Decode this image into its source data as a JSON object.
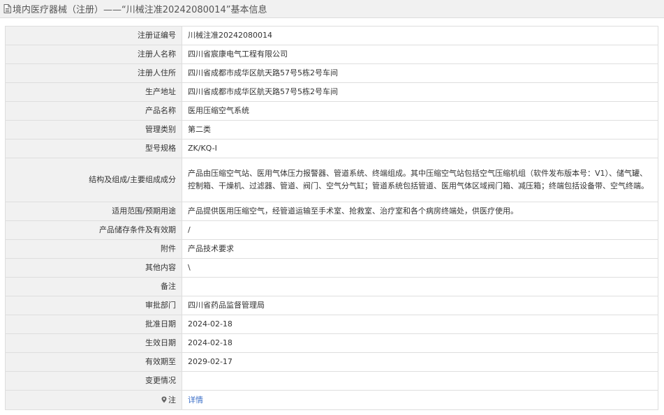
{
  "header": {
    "title": "境内医疗器械（注册）——“川械注准20242080014”基本信息"
  },
  "rows": [
    {
      "label": "注册证编号",
      "value": "川械注准20242080014"
    },
    {
      "label": "注册人名称",
      "value": "四川省宸康电气工程有限公司"
    },
    {
      "label": "注册人住所",
      "value": "四川省成都市成华区航天路57号5栋2号车间"
    },
    {
      "label": "生产地址",
      "value": "四川省成都市成华区航天路57号5栋2号车间"
    },
    {
      "label": "产品名称",
      "value": "医用压缩空气系统"
    },
    {
      "label": "管理类别",
      "value": "第二类"
    },
    {
      "label": "型号规格",
      "value": "ZK/KQ-I"
    },
    {
      "label": "结构及组成/主要组成成分",
      "value": "产品由压缩空气站、医用气体压力报警器、管道系统、终端组成。其中压缩空气站包括空气压缩机组（软件发布版本号：V1）、储气罐、控制箱、干燥机、过滤器、管道、阀门、空气分气缸；管道系统包括管道、医用气体区域阀门箱、减压箱；终端包括设备带、空气终端。"
    },
    {
      "label": "适用范围/预期用途",
      "value": "产品提供医用压缩空气，经管道运输至手术室、抢救室、治疗室和各个病房终端处，供医疗使用。"
    },
    {
      "label": "产品储存条件及有效期",
      "value": "/"
    },
    {
      "label": "附件",
      "value": "产品技术要求"
    },
    {
      "label": "其他内容",
      "value": "\\"
    },
    {
      "label": "备注",
      "value": ""
    },
    {
      "label": "审批部门",
      "value": "四川省药品监督管理局"
    },
    {
      "label": "批准日期",
      "value": "2024-02-18"
    },
    {
      "label": "生效日期",
      "value": "2024-02-18"
    },
    {
      "label": "有效期至",
      "value": "2029-02-17"
    },
    {
      "label": "变更情况",
      "value": ""
    },
    {
      "label": "注",
      "value": "详情"
    }
  ],
  "icons": {
    "title": "document-icon",
    "note": "map-pin-icon"
  },
  "colors": {
    "label_bg": "#f1f1f1",
    "border": "#dedede",
    "link": "#3a6ec7"
  }
}
